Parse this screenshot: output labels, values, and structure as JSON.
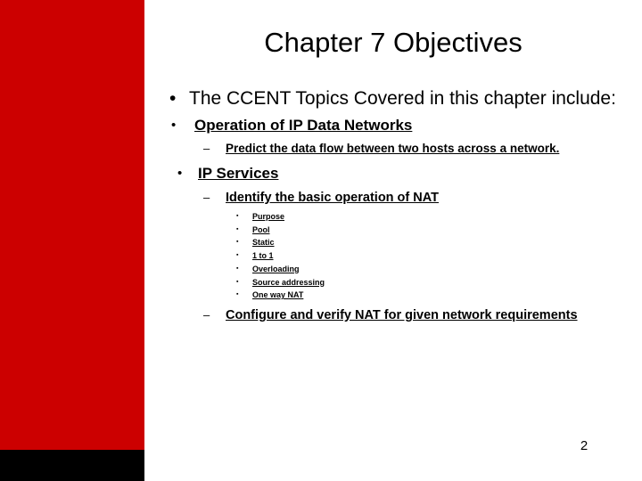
{
  "slide": {
    "title": "Chapter 7 Objectives",
    "page_number": "2",
    "colors": {
      "sidebar_red": "#cc0000",
      "sidebar_black": "#000000",
      "background": "#ffffff",
      "text": "#000000"
    },
    "bullets": {
      "intro": {
        "marker": "•",
        "text": "The CCENT Topics Covered in this chapter include:"
      },
      "topic_1": {
        "marker": "•",
        "text": "Operation of IP Data Networks"
      },
      "topic_1_item_1": {
        "marker": "–",
        "text": "Predict the data flow between two hosts across a network."
      },
      "topic_2": {
        "marker": "•",
        "text": "IP Services"
      },
      "topic_2_item_1": {
        "marker": "–",
        "text": "Identify the basic operation of NAT"
      },
      "topic_2_item_1_subitems": [
        {
          "marker": "▪",
          "text": "Purpose"
        },
        {
          "marker": "▪",
          "text": "Pool"
        },
        {
          "marker": "▪",
          "text": "Static"
        },
        {
          "marker": "▪",
          "text": "1 to 1"
        },
        {
          "marker": "▪",
          "text": "Overloading"
        },
        {
          "marker": "▪",
          "text": "Source addressing"
        },
        {
          "marker": "▪",
          "text": "One way NAT"
        }
      ],
      "topic_2_item_2": {
        "marker": "–",
        "text": "Configure and verify NAT for given network requirements"
      }
    }
  }
}
